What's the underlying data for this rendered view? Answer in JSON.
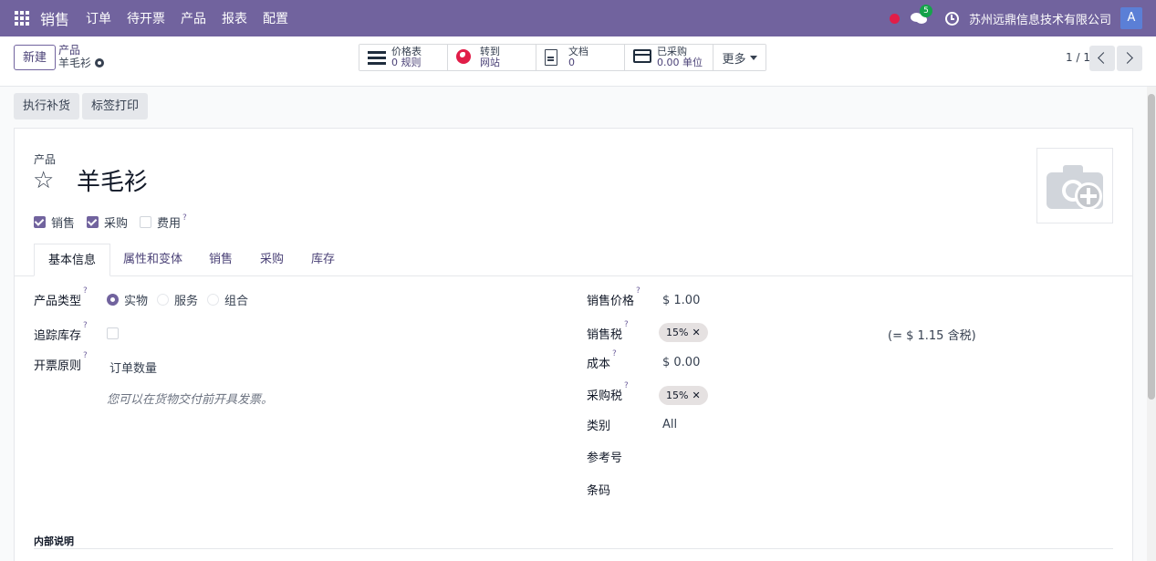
{
  "navbar": {
    "app_name": "销售",
    "menu": [
      "订单",
      "待开票",
      "产品",
      "报表",
      "配置"
    ],
    "chat_count": "5",
    "company": "苏州远鼎信息技术有限公司",
    "avatar_letter": "A"
  },
  "control": {
    "new_label": "新建",
    "breadcrumb_parent": "产品",
    "breadcrumb_current": "羊毛衫",
    "smart_buttons": [
      {
        "title": "价格表",
        "sub": "0 规则"
      },
      {
        "title": "转到",
        "sub": "网站"
      },
      {
        "title": "文档",
        "sub": "0"
      },
      {
        "title": "已采购",
        "sub": "0.00 单位"
      }
    ],
    "more_label": "更多",
    "pager": "1 / 1"
  },
  "actions": {
    "replenish": "执行补货",
    "print_labels": "标签打印"
  },
  "product": {
    "label": "产品",
    "name": "羊毛衫",
    "checkboxes": [
      {
        "label": "销售",
        "checked": true
      },
      {
        "label": "采购",
        "checked": true
      },
      {
        "label": "费用",
        "checked": false
      }
    ]
  },
  "tabs": [
    "基本信息",
    "属性和变体",
    "销售",
    "采购",
    "库存"
  ],
  "left_fields": {
    "product_type_label": "产品类型",
    "product_type_options": [
      "实物",
      "服务",
      "组合"
    ],
    "track_inventory_label": "追踪库存",
    "invoice_policy_label": "开票原则",
    "invoice_policy_value": "订单数量",
    "invoice_hint": "您可以在货物交付前开具发票。"
  },
  "right_fields": {
    "sales_price_label": "销售价格",
    "sales_price_value": "$ 1.00",
    "sales_tax_label": "销售税",
    "sales_tax_tag": "15%",
    "tax_included_note": "(= $ 1.15 含税)",
    "cost_label": "成本",
    "cost_value": "$ 0.00",
    "purchase_tax_label": "采购税",
    "purchase_tax_tag": "15%",
    "category_label": "类别",
    "category_value": "All",
    "reference_label": "参考号",
    "barcode_label": "条码"
  },
  "internal_notes_title": "内部说明",
  "help_mark": "?",
  "colors": {
    "brand": "#71639e",
    "badge_green": "#15a34a",
    "alert_red": "#e11d48"
  }
}
